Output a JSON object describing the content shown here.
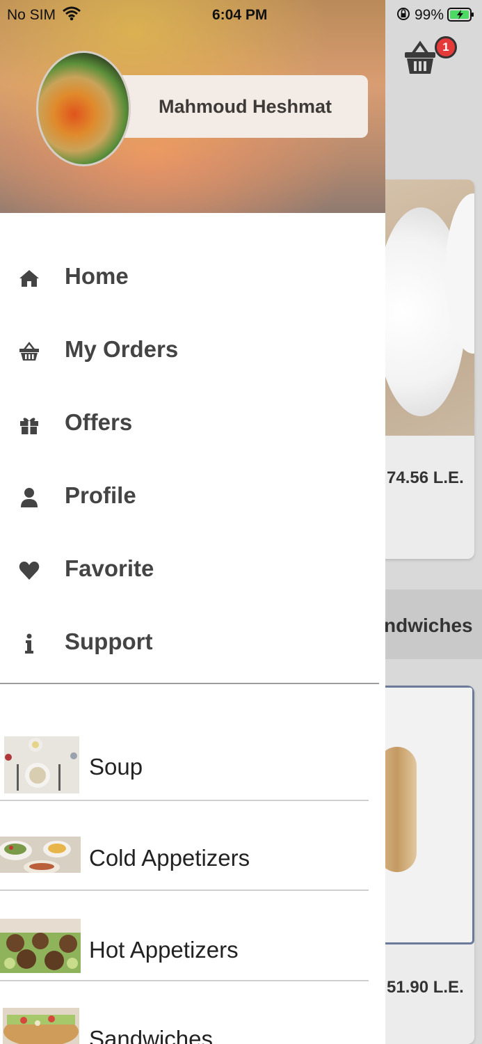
{
  "status_bar": {
    "carrier": "No SIM",
    "time": "6:04 PM",
    "battery": "99%"
  },
  "drawer": {
    "user_name": "Mahmoud Heshmat",
    "menu": [
      {
        "label": "Home",
        "icon": "home-icon"
      },
      {
        "label": "My Orders",
        "icon": "basket-icon"
      },
      {
        "label": "Offers",
        "icon": "gift-icon"
      },
      {
        "label": "Profile",
        "icon": "person-icon"
      },
      {
        "label": "Favorite",
        "icon": "heart-icon"
      },
      {
        "label": "Support",
        "icon": "info-icon"
      }
    ],
    "categories": [
      {
        "label": "Soup"
      },
      {
        "label": "Cold Appetizers"
      },
      {
        "label": "Hot Appetizers"
      },
      {
        "label": "Sandwiches"
      }
    ]
  },
  "background": {
    "cart_count": "1",
    "items": [
      {
        "price": "74.56 L.E."
      },
      {
        "price": "51.90 L.E."
      }
    ],
    "section_label": "ndwiches"
  }
}
